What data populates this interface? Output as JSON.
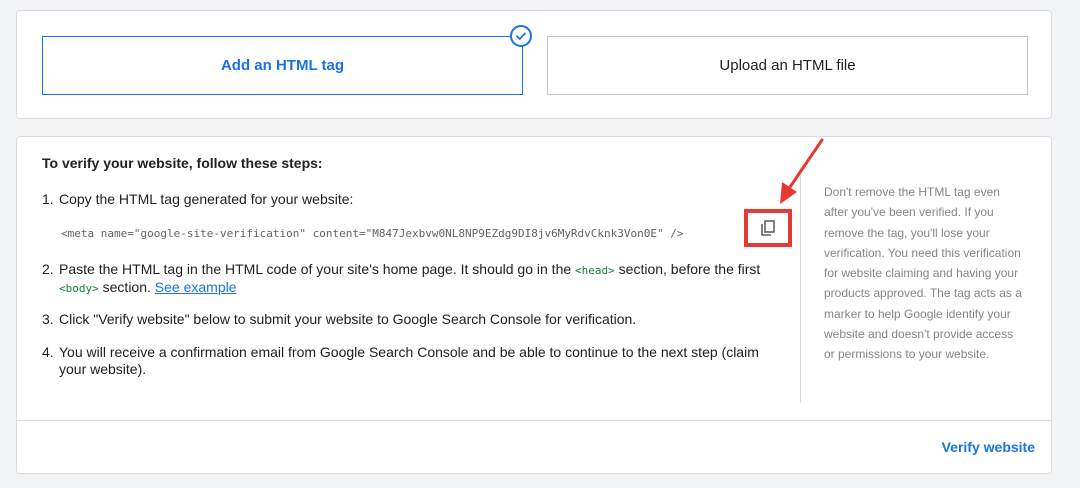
{
  "methods": {
    "html_tag_label": "Add an HTML tag",
    "html_file_label": "Upload an HTML file"
  },
  "instructions": {
    "title": "To verify your website, follow these steps:",
    "step1": {
      "num": "1.",
      "text": "Copy the HTML tag generated for your website:"
    },
    "meta_tag": "<meta name=\"google-site-verification\" content=\"M847Jexbvw0NL8NP9EZdg9DI8jv6MyRdvCknk3Von0E\" />",
    "step2": {
      "num": "2.",
      "text_a": "Paste the HTML tag in the HTML code of your site's home page. It should go in the",
      "head_tag": "<head>",
      "text_b": "section, before the first",
      "body_tag": "<body>",
      "text_c": "section.",
      "link": "See example"
    },
    "step3": {
      "num": "3.",
      "text": "Click \"Verify website\" below to submit your website to Google Search Console for verification."
    },
    "step4": {
      "num": "4.",
      "text": "You will receive a confirmation email from Google Search Console and be able to continue to the next step (claim your website)."
    }
  },
  "side_note": "Don't remove the HTML tag even after you've been verified. If you remove the tag, you'll lose your verification. You need this verification for website claiming and having your products approved. The tag acts as a marker to help Google identify your website and doesn't provide access or permissions to your website.",
  "actions": {
    "verify_label": "Verify website"
  },
  "icons": {
    "check": "check-circle-icon",
    "copy": "copy-icon",
    "arrow": "arrow-annotation-icon"
  },
  "colors": {
    "accent": "#1a73e8",
    "annotation": "#e53935",
    "code_green": "#188038"
  }
}
